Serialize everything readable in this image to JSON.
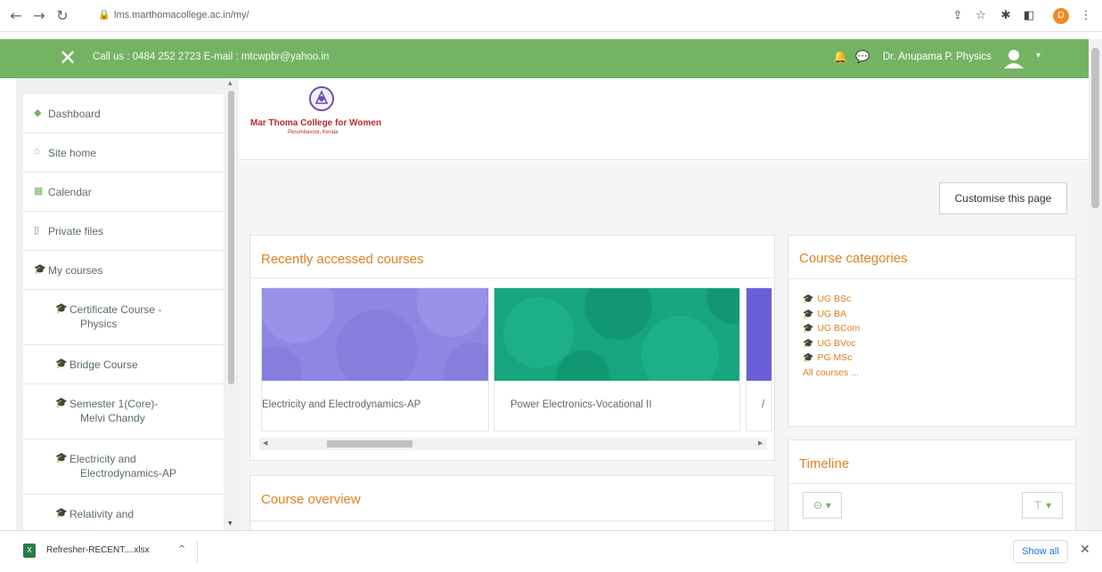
{
  "browser": {
    "url": "lms.marthomacollege.ac.in/my/",
    "profile_initial": "D"
  },
  "topnav": {
    "contact": "Call us : 0484 252 2723 E-mail : mtcwpbr@yahoo.in",
    "user_name": "Dr. Anupama P. Physics"
  },
  "logo": {
    "name": "Mar Thoma College for Women",
    "subtitle": "Perumbavoor, Kerala"
  },
  "sidebar": {
    "items": [
      {
        "label": "Dashboard",
        "icon": "dashboard-icon"
      },
      {
        "label": "Site home",
        "icon": "home-icon"
      },
      {
        "label": "Calendar",
        "icon": "calendar-icon"
      },
      {
        "label": "Private files",
        "icon": "file-icon"
      },
      {
        "label": "My courses",
        "icon": "graduation-cap-icon"
      }
    ],
    "courses": [
      {
        "line1": "Certificate Course -",
        "line2": "Physics"
      },
      {
        "line1": "Bridge Course",
        "line2": ""
      },
      {
        "line1": "Semester 1(Core)-",
        "line2": "Melvi Chandy"
      },
      {
        "line1": "Electricity and",
        "line2": "Electrodynamics-AP"
      },
      {
        "line1": "Relativity and",
        "line2": ""
      }
    ]
  },
  "main": {
    "customise_label": "Customise this page",
    "recent_title": "Recently accessed courses",
    "recent_courses": [
      {
        "name": "Electricity and Electrodynamics-AP",
        "color": "#8f86e4"
      },
      {
        "name": "Power Electronics-Vocational II",
        "color": "#16a57e"
      },
      {
        "name": "/",
        "color": "#6a5fd8"
      }
    ],
    "overview_title": "Course overview",
    "categories_title": "Course categories",
    "categories": [
      "UG BSc",
      "UG BA",
      "UG BCom",
      "UG BVoc",
      "PG MSc"
    ],
    "all_courses": "All courses ...",
    "timeline_title": "Timeline"
  },
  "download": {
    "file_name": "Refresher-RECENT....xlsx",
    "show_all": "Show all"
  },
  "colors": {
    "brand_green": "#74b364",
    "accent_orange": "#e0801f"
  }
}
